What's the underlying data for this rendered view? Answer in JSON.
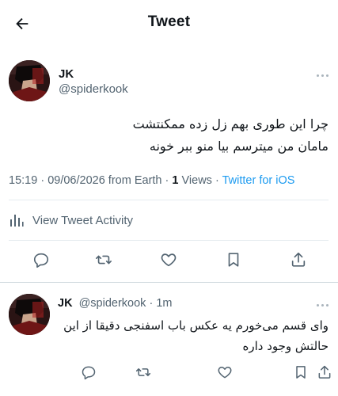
{
  "header": {
    "title": "Tweet",
    "back_icon": "arrow-left-icon"
  },
  "tweet": {
    "author_name": "JK",
    "author_handle": "@spiderkook",
    "text_lines": [
      "چرا این طوری بهم زل زده ممکنتشت",
      "مامان من میترسم بیا منو ببر خونه"
    ],
    "time": "15:19",
    "separator": "·",
    "date": "09/06/2026 from Earth",
    "views_count": "1",
    "views_label": "Views",
    "source": "Twitter for iOS",
    "activity_label": "View Tweet Activity"
  },
  "reply": {
    "author_name": "JK",
    "author_handle": "@spiderkook",
    "separator": "·",
    "time": "1m",
    "text_lines": [
      "وای قسم می‌خورم یه عکس باب اسفنجی دقیقا از این",
      "حالتش وجود داره"
    ]
  },
  "icons": {
    "reply": "comment-bubble-icon",
    "retweet": "retweet-arrows-icon",
    "like": "heart-icon",
    "bookmark": "bookmark-icon",
    "share": "share-icon",
    "more": "more-dots-icon",
    "activity": "bar-chart-icon"
  },
  "colors": {
    "text": "#0f1419",
    "secondary": "#536471",
    "accent": "#1d9bf0",
    "divider": "#e6ecf0"
  }
}
